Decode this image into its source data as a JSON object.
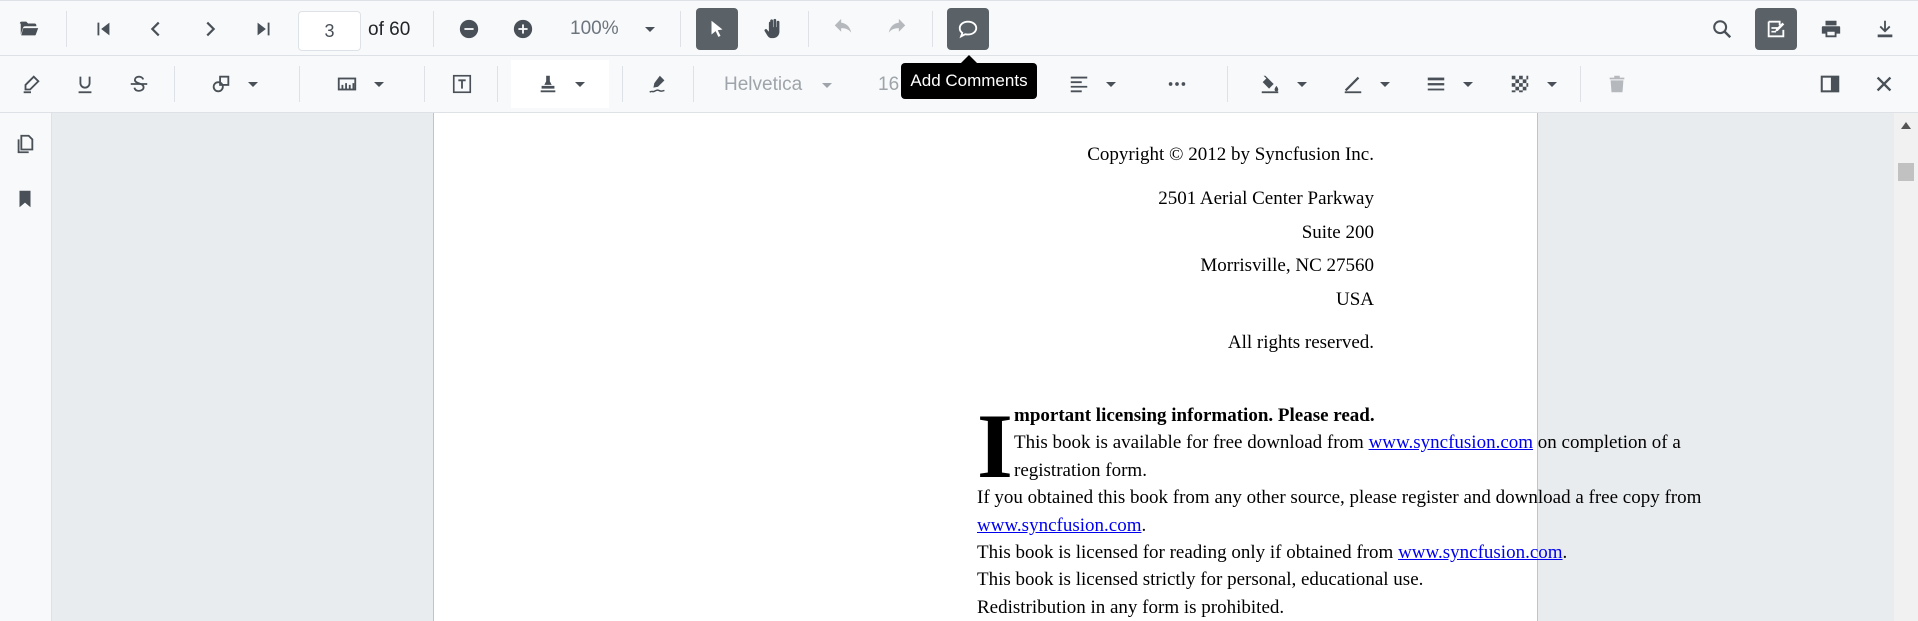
{
  "navigation": {
    "current_page": "3",
    "page_total": "of 60",
    "zoom": "100%"
  },
  "annotation_toolbar": {
    "font_family": "Helvetica",
    "font_size": "16"
  },
  "tooltip": {
    "text": "Add Comments"
  },
  "document": {
    "copyright": "Copyright © 2012 by Syncfusion Inc.",
    "address": [
      "2501 Aerial Center Parkway",
      "Suite 200",
      "Morrisville, NC 27560",
      "USA"
    ],
    "rights": "All rights reserved.",
    "dropcap": "I",
    "heading": "mportant licensing information. Please read.",
    "para1_text": "This book is available for free download from ",
    "para1_link": "www.syncfusion.com",
    "para1_tail": " on completion of a",
    "para1_line2": "registration form.",
    "para2_text": "If you obtained this book from any other source, please register and download a free copy from",
    "para2_link": "www.syncfusion.com",
    "para2_tail": ".",
    "para3_text": "This book is licensed for reading only if obtained from ",
    "para3_link": "www.syncfusion.com",
    "para3_tail": ".",
    "para4": "This book is licensed strictly for personal, educational use.",
    "para5": "Redistribution in any form is prohibited."
  },
  "icons": {
    "open": "folder-open-icon",
    "first": "first-page-icon",
    "prev": "previous-page-icon",
    "next": "next-page-icon",
    "last": "last-page-icon",
    "zoom_out": "zoom-out-icon",
    "zoom_in": "zoom-in-icon",
    "select": "text-select-pointer-icon",
    "pan": "pan-hand-icon",
    "undo": "undo-icon",
    "redo": "redo-icon",
    "comment": "comment-icon",
    "search": "search-icon",
    "annotation": "edit-annotation-icon",
    "print": "print-icon",
    "download": "download-icon"
  },
  "colors": {
    "accent_active": "#5a6268",
    "link": "#0000ee",
    "tooltip_bg": "#000000"
  }
}
